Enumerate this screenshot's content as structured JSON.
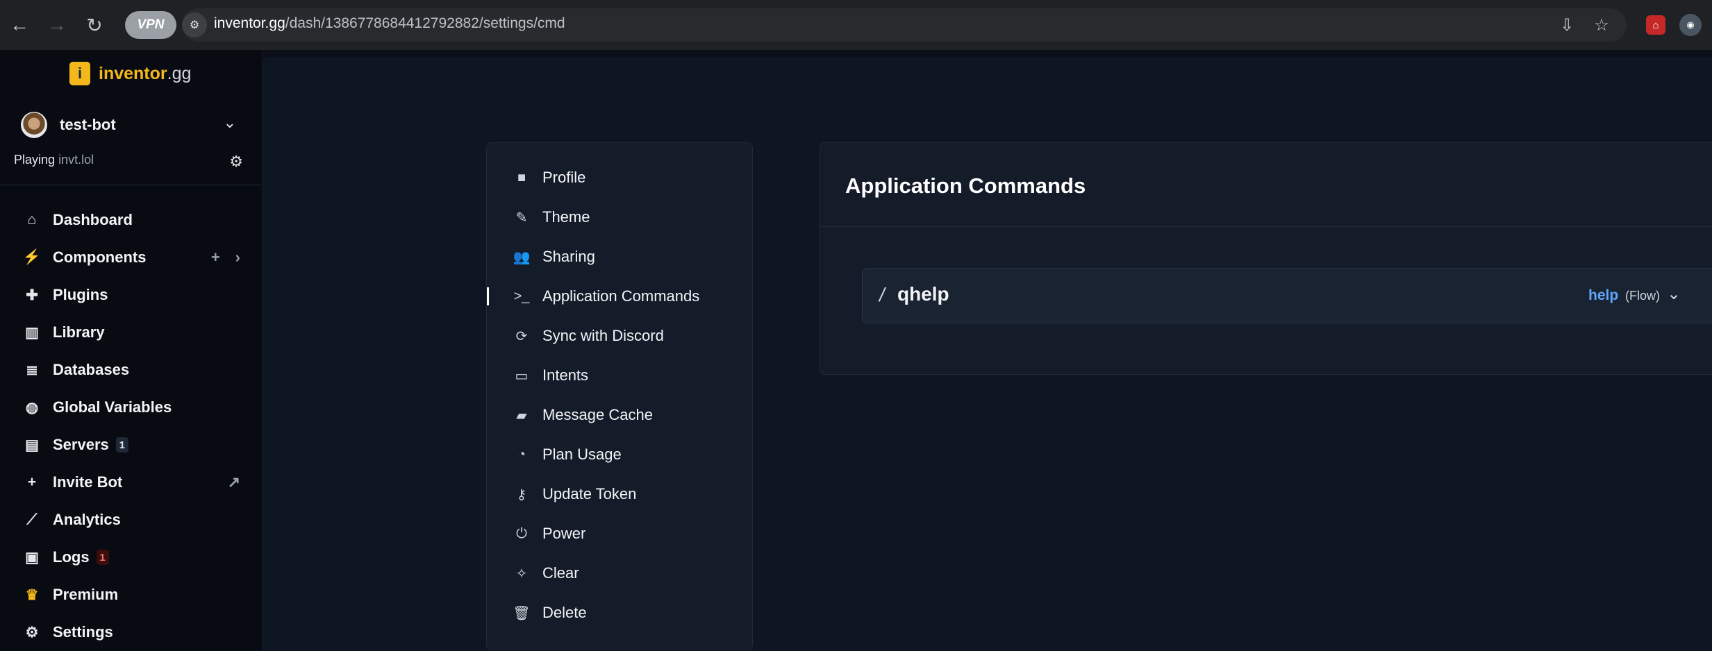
{
  "browser": {
    "vpn_label": "VPN",
    "url_host": "inventor.gg",
    "url_path": "/dash/1386778684412792882/settings/cmd"
  },
  "brand": {
    "logo_glyph": "i",
    "name_part1": "inventor",
    "name_part2": ".gg"
  },
  "bot": {
    "name": "test-bot",
    "status_prefix": "Playing",
    "status_game": "invt.lol"
  },
  "sidebar": {
    "items": [
      {
        "label": "Dashboard",
        "icon": "home-icon"
      },
      {
        "label": "Components",
        "icon": "bolt-icon"
      },
      {
        "label": "Plugins",
        "icon": "puzzle-icon"
      },
      {
        "label": "Library",
        "icon": "books-icon"
      },
      {
        "label": "Databases",
        "icon": "database-icon"
      },
      {
        "label": "Global Variables",
        "icon": "globe-icon"
      },
      {
        "label": "Servers",
        "icon": "server-icon",
        "badge": "1"
      },
      {
        "label": "Invite Bot",
        "icon": "plus-icon"
      },
      {
        "label": "Analytics",
        "icon": "chart-line-icon"
      },
      {
        "label": "Logs",
        "icon": "scroll-icon",
        "badge": "1"
      },
      {
        "label": "Premium",
        "icon": "crown-icon"
      },
      {
        "label": "Settings",
        "icon": "gear-icon"
      }
    ]
  },
  "settings_nav": {
    "items": [
      {
        "label": "Profile",
        "icon": "robot-icon"
      },
      {
        "label": "Theme",
        "icon": "brush-icon"
      },
      {
        "label": "Sharing",
        "icon": "users-icon"
      },
      {
        "label": "Application Commands",
        "icon": "terminal-icon",
        "active": true
      },
      {
        "label": "Sync with Discord",
        "icon": "sync-icon"
      },
      {
        "label": "Intents",
        "icon": "id-card-icon"
      },
      {
        "label": "Message Cache",
        "icon": "comments-icon"
      },
      {
        "label": "Plan Usage",
        "icon": "pie-chart-icon"
      },
      {
        "label": "Update Token",
        "icon": "key-icon"
      },
      {
        "label": "Power",
        "icon": "power-icon"
      },
      {
        "label": "Clear",
        "icon": "broom-icon"
      },
      {
        "label": "Delete",
        "icon": "trash-icon"
      }
    ]
  },
  "commands": {
    "title": "Application Commands",
    "items": [
      {
        "slash": "/",
        "name": "qhelp",
        "flow": "help",
        "flow_type": "(Flow)"
      }
    ]
  },
  "colors": {
    "accent": "#f5b81b",
    "link": "#60a5fa",
    "background": "#0f1623",
    "card": "#141c2a"
  }
}
